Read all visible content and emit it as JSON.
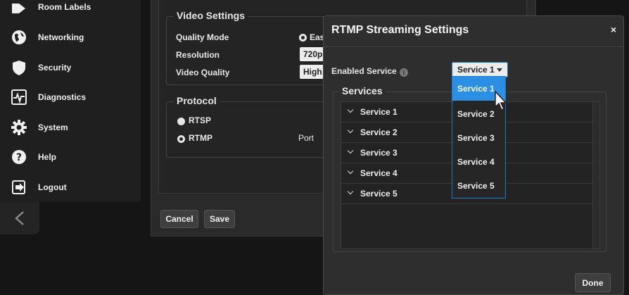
{
  "sidebar": {
    "items": [
      {
        "label": "Room Labels",
        "icon": "tag-icon"
      },
      {
        "label": "Networking",
        "icon": "globe-icon"
      },
      {
        "label": "Security",
        "icon": "shield-icon"
      },
      {
        "label": "Diagnostics",
        "icon": "pulse-icon"
      },
      {
        "label": "System",
        "icon": "gear-icon"
      },
      {
        "label": "Help",
        "icon": "question-icon"
      },
      {
        "label": "Logout",
        "icon": "logout-icon"
      }
    ],
    "collapse_glyph": "<"
  },
  "video_settings": {
    "legend": "Video Settings",
    "quality_mode_label": "Quality Mode",
    "quality_mode_value": "Eas",
    "resolution_label": "Resolution",
    "resolution_value": "720p",
    "video_quality_label": "Video Quality",
    "video_quality_value": "High"
  },
  "protocol": {
    "legend": "Protocol",
    "options": [
      {
        "label": "RTSP",
        "selected": false
      },
      {
        "label": "RTMP",
        "selected": true
      }
    ],
    "port_label": "Port"
  },
  "form_buttons": {
    "cancel": "Cancel",
    "save": "Save"
  },
  "dialog": {
    "title": "RTMP Streaming Settings",
    "close": "×",
    "enabled_service_label": "Enabled Service",
    "info_glyph": "i",
    "enabled_service_value": "Service 1",
    "services_legend": "Services",
    "services": [
      "Service 1",
      "Service 2",
      "Service 3",
      "Service 4",
      "Service 5"
    ],
    "done": "Done"
  },
  "dropdown": {
    "options": [
      "Service 1",
      "Service 2",
      "Service 3",
      "Service 4",
      "Service 5"
    ],
    "selected_index": 0
  },
  "colors": {
    "accent": "#2b8fe3",
    "select_border": "#1e78c8"
  }
}
